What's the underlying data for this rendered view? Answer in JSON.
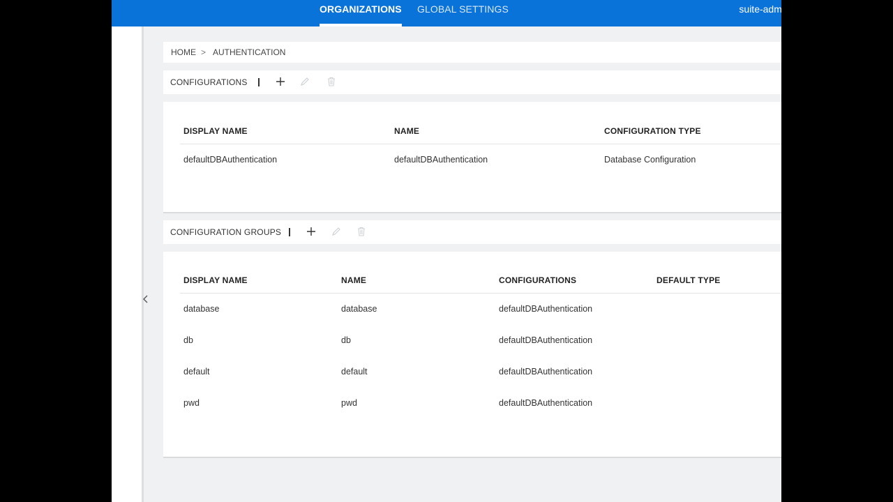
{
  "topbar": {
    "tabs": [
      {
        "label": "ORGANIZATIONS",
        "active": true
      },
      {
        "label": "GLOBAL SETTINGS",
        "active": false
      }
    ],
    "user": "suite-admi"
  },
  "breadcrumb": {
    "home": "HOME",
    "separator": ">",
    "current": "AUTHENTICATION"
  },
  "configurations": {
    "label": "CONFIGURATIONS",
    "columns": [
      "DISPLAY NAME",
      "NAME",
      "CONFIGURATION TYPE"
    ],
    "rows": [
      {
        "display_name": "defaultDBAuthentication",
        "name": "defaultDBAuthentication",
        "type": "Database Configuration"
      }
    ]
  },
  "configuration_groups": {
    "label": "CONFIGURATION GROUPS",
    "columns": [
      "DISPLAY NAME",
      "NAME",
      "CONFIGURATIONS",
      "DEFAULT TYPE"
    ],
    "rows": [
      {
        "display_name": "database",
        "name": "database",
        "configurations": "defaultDBAuthentication",
        "default_type": ""
      },
      {
        "display_name": "db",
        "name": "db",
        "configurations": "defaultDBAuthentication",
        "default_type": ""
      },
      {
        "display_name": "default",
        "name": "default",
        "configurations": "defaultDBAuthentication",
        "default_type": ""
      },
      {
        "display_name": "pwd",
        "name": "pwd",
        "configurations": "defaultDBAuthentication",
        "default_type": ""
      }
    ]
  },
  "icons": {
    "add": "plus-icon",
    "edit": "pencil-icon",
    "delete": "trash-icon",
    "collapse": "chevron-left-icon"
  },
  "colors": {
    "header": "#0a73d9",
    "background": "#f0f1f2",
    "disabled_icon": "#cfd2d5"
  }
}
